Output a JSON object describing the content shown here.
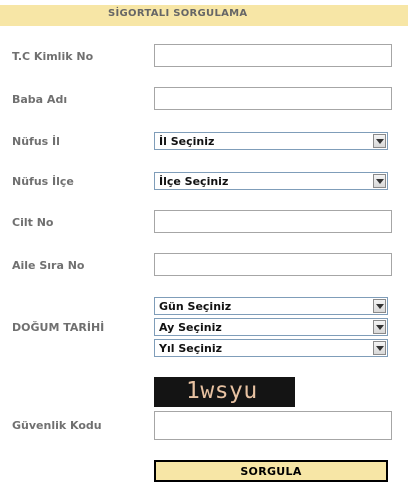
{
  "header": {
    "title": "SİGORTALI SORGULAMA"
  },
  "form": {
    "tc_kimlik_no": {
      "label": "T.C Kimlik No",
      "value": ""
    },
    "baba_adi": {
      "label": "Baba Adı",
      "value": ""
    },
    "nufus_il": {
      "label": "Nüfus İl",
      "selected": "İl Seçiniz"
    },
    "nufus_ilce": {
      "label": "Nüfus İlçe",
      "selected": "İlçe Seçiniz"
    },
    "cilt_no": {
      "label": "Cilt No",
      "value": ""
    },
    "aile_sira_no": {
      "label": "Aile Sıra No",
      "value": ""
    },
    "dogum_tarihi": {
      "label": "DOĞUM TARİHİ",
      "day_selected": "Gün Seçiniz",
      "month_selected": "Ay Seçiniz",
      "year_selected": "Yıl Seçiniz"
    },
    "guvenlik_kodu": {
      "label": "Güvenlik Kodu",
      "captcha_text": "1wsyu",
      "value": ""
    },
    "submit_label": "SORGULA"
  },
  "colors": {
    "accent_bar": "#f7e6a6",
    "label_text": "#707070",
    "captcha_bg": "#141414",
    "captcha_text": "#e8c2a2"
  },
  "icons": {
    "select_arrow": "chevron-down-icon"
  }
}
